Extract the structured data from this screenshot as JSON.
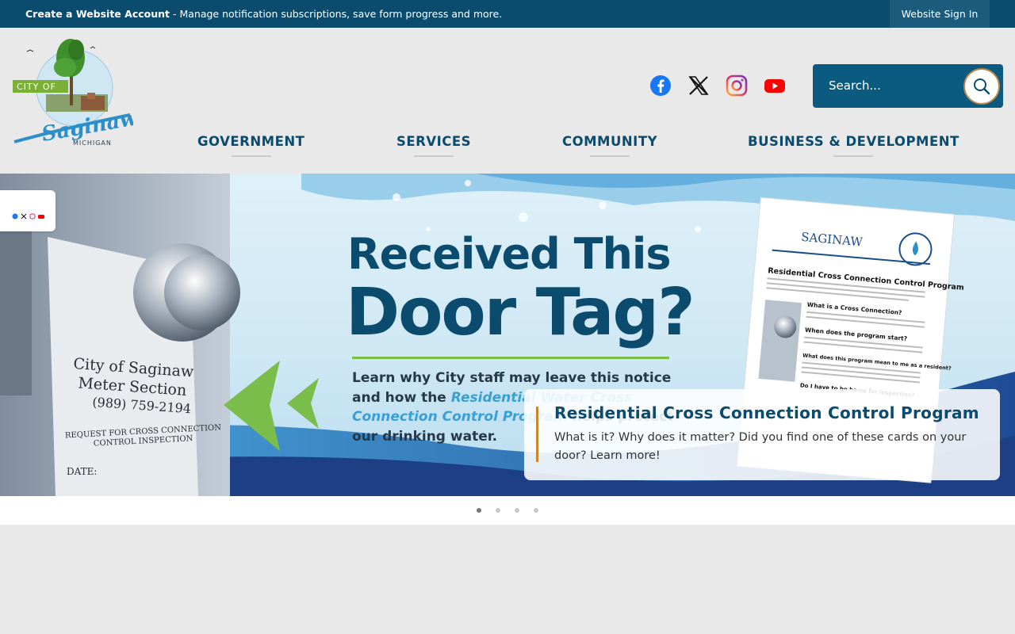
{
  "topbar": {
    "account_link": "Create a Website Account",
    "account_tail": " - Manage notification subscriptions, save form progress and more.",
    "signin": "Website Sign In"
  },
  "logo": {
    "city_of": "CITY OF",
    "saginaw": "Saginaw",
    "michigan": "MICHIGAN"
  },
  "social": [
    "facebook-icon",
    "x-icon",
    "instagram-icon",
    "youtube-icon"
  ],
  "search": {
    "placeholder": "Search..."
  },
  "nav": {
    "government": "GOVERNMENT",
    "services": "SERVICES",
    "community": "COMMUNITY",
    "business": "BUSINESS & DEVELOPMENT"
  },
  "hero": {
    "headline1": "Received This",
    "headline2": "Door Tag?",
    "body_pre": "Learn why City staff may leave this notice and how the ",
    "body_em": "Residential Water Cross Connection Control Program",
    "body_post": " helps protect our drinking water.",
    "tag_line1": "City of Saginaw",
    "tag_line2": "Meter Section",
    "tag_phone": "(989) 759-2194",
    "tag_line3": "REQUEST FOR CROSS CONNECTION",
    "tag_line4": "CONTROL INSPECTION",
    "tag_date": "DATE:",
    "doc_title": "Residential Cross Connection Control Program",
    "doc_q1": "What is a Cross Connection?",
    "doc_q2": "When does the program start?",
    "doc_q3": "What does this program mean to me as a resident?",
    "doc_q4": "Do I have to be home for inspection?"
  },
  "caption": {
    "title": "Residential Cross Connection Control Program",
    "desc": "What is it? Why does it matter? Did you find one of these cards on your door? Learn more!"
  },
  "carousel": {
    "slides": 4,
    "active": 1
  },
  "colors": {
    "brand": "#0b4b6e",
    "accent": "#c9862e",
    "green": "#7bbd4a"
  }
}
